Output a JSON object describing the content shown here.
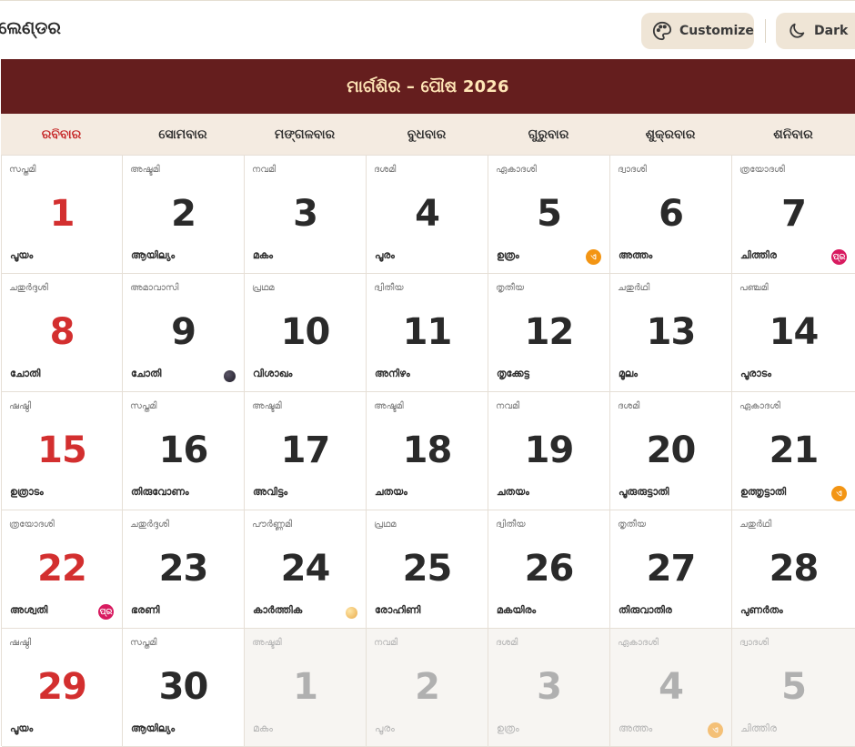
{
  "app": {
    "title": "ଲେଣ୍ଡର"
  },
  "toolbar": {
    "customize_label": "Customize",
    "dark_label": "Dark",
    "customize_icon": "palette-icon",
    "dark_icon": "moon-icon"
  },
  "month": {
    "title": "ମାର୍ଗଶିର – ପୌଷ 2026"
  },
  "weekdays": [
    "ରବିବାର",
    "ସୋମବାର",
    "ମଙ୍ଗଳବାର",
    "ବୁଧବାର",
    "ଗୁରୁବାର",
    "ଶୁକ୍ରବାର",
    "ଶନିବାର"
  ],
  "colors": {
    "banner": "#651e1e",
    "banner_text": "#ffe6b6",
    "sunday": "#d32f2f",
    "badge_orange": "#f39514",
    "badge_pink": "#d81b60"
  },
  "days": [
    {
      "day": "1",
      "tithi": "സപ്തമി",
      "nakshatra": "പൂയം",
      "sun": true
    },
    {
      "day": "2",
      "tithi": "അഷ്ടമി",
      "nakshatra": "ആയില്യം"
    },
    {
      "day": "3",
      "tithi": "നവമി",
      "nakshatra": "മകം"
    },
    {
      "day": "4",
      "tithi": "ദശമി",
      "nakshatra": "പൂരം"
    },
    {
      "day": "5",
      "tithi": "ഏകാദശി",
      "nakshatra": "ഉത്രം",
      "badge": {
        "text": "ଏ",
        "type": "orange"
      }
    },
    {
      "day": "6",
      "tithi": "ദ്വാദശി",
      "nakshatra": "അത്തം"
    },
    {
      "day": "7",
      "tithi": "ത്രയോദശി",
      "nakshatra": "ചിത്തിര",
      "badge": {
        "text": "ପ୍ର",
        "type": "pink"
      }
    },
    {
      "day": "8",
      "tithi": "ചതുർദ്ദശി",
      "nakshatra": "ചോതി",
      "sun": true
    },
    {
      "day": "9",
      "tithi": "അമാവാസി",
      "nakshatra": "ചോതി",
      "moon": "new"
    },
    {
      "day": "10",
      "tithi": "പ്രഥമ",
      "nakshatra": "വിശാഖം"
    },
    {
      "day": "11",
      "tithi": "ദ്വിതീയ",
      "nakshatra": "അനിഴം"
    },
    {
      "day": "12",
      "tithi": "തൃതീയ",
      "nakshatra": "തൃക്കേട്ട"
    },
    {
      "day": "13",
      "tithi": "ചതുർഥി",
      "nakshatra": "മൂലം"
    },
    {
      "day": "14",
      "tithi": "പഞ്ചമി",
      "nakshatra": "പൂരാടം"
    },
    {
      "day": "15",
      "tithi": "ഷഷ്ഠി",
      "nakshatra": "ഉത്രാടം",
      "sun": true
    },
    {
      "day": "16",
      "tithi": "സപ്തമി",
      "nakshatra": "തിരുവോണം"
    },
    {
      "day": "17",
      "tithi": "അഷ്ടമി",
      "nakshatra": "അവിട്ടം"
    },
    {
      "day": "18",
      "tithi": "അഷ്ടമി",
      "nakshatra": "ചതയം"
    },
    {
      "day": "19",
      "tithi": "നവമി",
      "nakshatra": "ചതയം"
    },
    {
      "day": "20",
      "tithi": "ദശമി",
      "nakshatra": "പൂരുരുട്ടാതി"
    },
    {
      "day": "21",
      "tithi": "ഏകാദശി",
      "nakshatra": "ഉത്തൃട്ടാതി",
      "badge": {
        "text": "ଏ",
        "type": "orange"
      }
    },
    {
      "day": "22",
      "tithi": "ത്രയോദശി",
      "nakshatra": "അശ്വതി",
      "sun": true,
      "badge": {
        "text": "ପ୍ର",
        "type": "pink"
      }
    },
    {
      "day": "23",
      "tithi": "ചതുർദ്ദശി",
      "nakshatra": "ഭരണി"
    },
    {
      "day": "24",
      "tithi": "പൗർണ്ണമി",
      "nakshatra": "കാർത്തിക",
      "moon": "full"
    },
    {
      "day": "25",
      "tithi": "പ്രഥമ",
      "nakshatra": "രോഹിണി"
    },
    {
      "day": "26",
      "tithi": "ദ്വിതീയ",
      "nakshatra": "മകയിരം"
    },
    {
      "day": "27",
      "tithi": "തൃതീയ",
      "nakshatra": "തിരുവാതിര"
    },
    {
      "day": "28",
      "tithi": "ചതുർഥി",
      "nakshatra": "പുണർതം"
    },
    {
      "day": "29",
      "tithi": "ഷഷ്ഠി",
      "nakshatra": "പൂയം",
      "sun": true
    },
    {
      "day": "30",
      "tithi": "സപ്തമി",
      "nakshatra": "ആയില്യം"
    },
    {
      "day": "1",
      "tithi": "അഷ്ടമി",
      "nakshatra": "മകം",
      "other": true
    },
    {
      "day": "2",
      "tithi": "നവമി",
      "nakshatra": "പൂരം",
      "other": true
    },
    {
      "day": "3",
      "tithi": "ദശമി",
      "nakshatra": "ഉത്രം",
      "other": true
    },
    {
      "day": "4",
      "tithi": "ഏകാദശി",
      "nakshatra": "അത്തം",
      "other": true,
      "badge": {
        "text": "ଏ",
        "type": "orange"
      }
    },
    {
      "day": "5",
      "tithi": "ദ്വാദശി",
      "nakshatra": "ചിത്തിര",
      "other": true
    }
  ]
}
